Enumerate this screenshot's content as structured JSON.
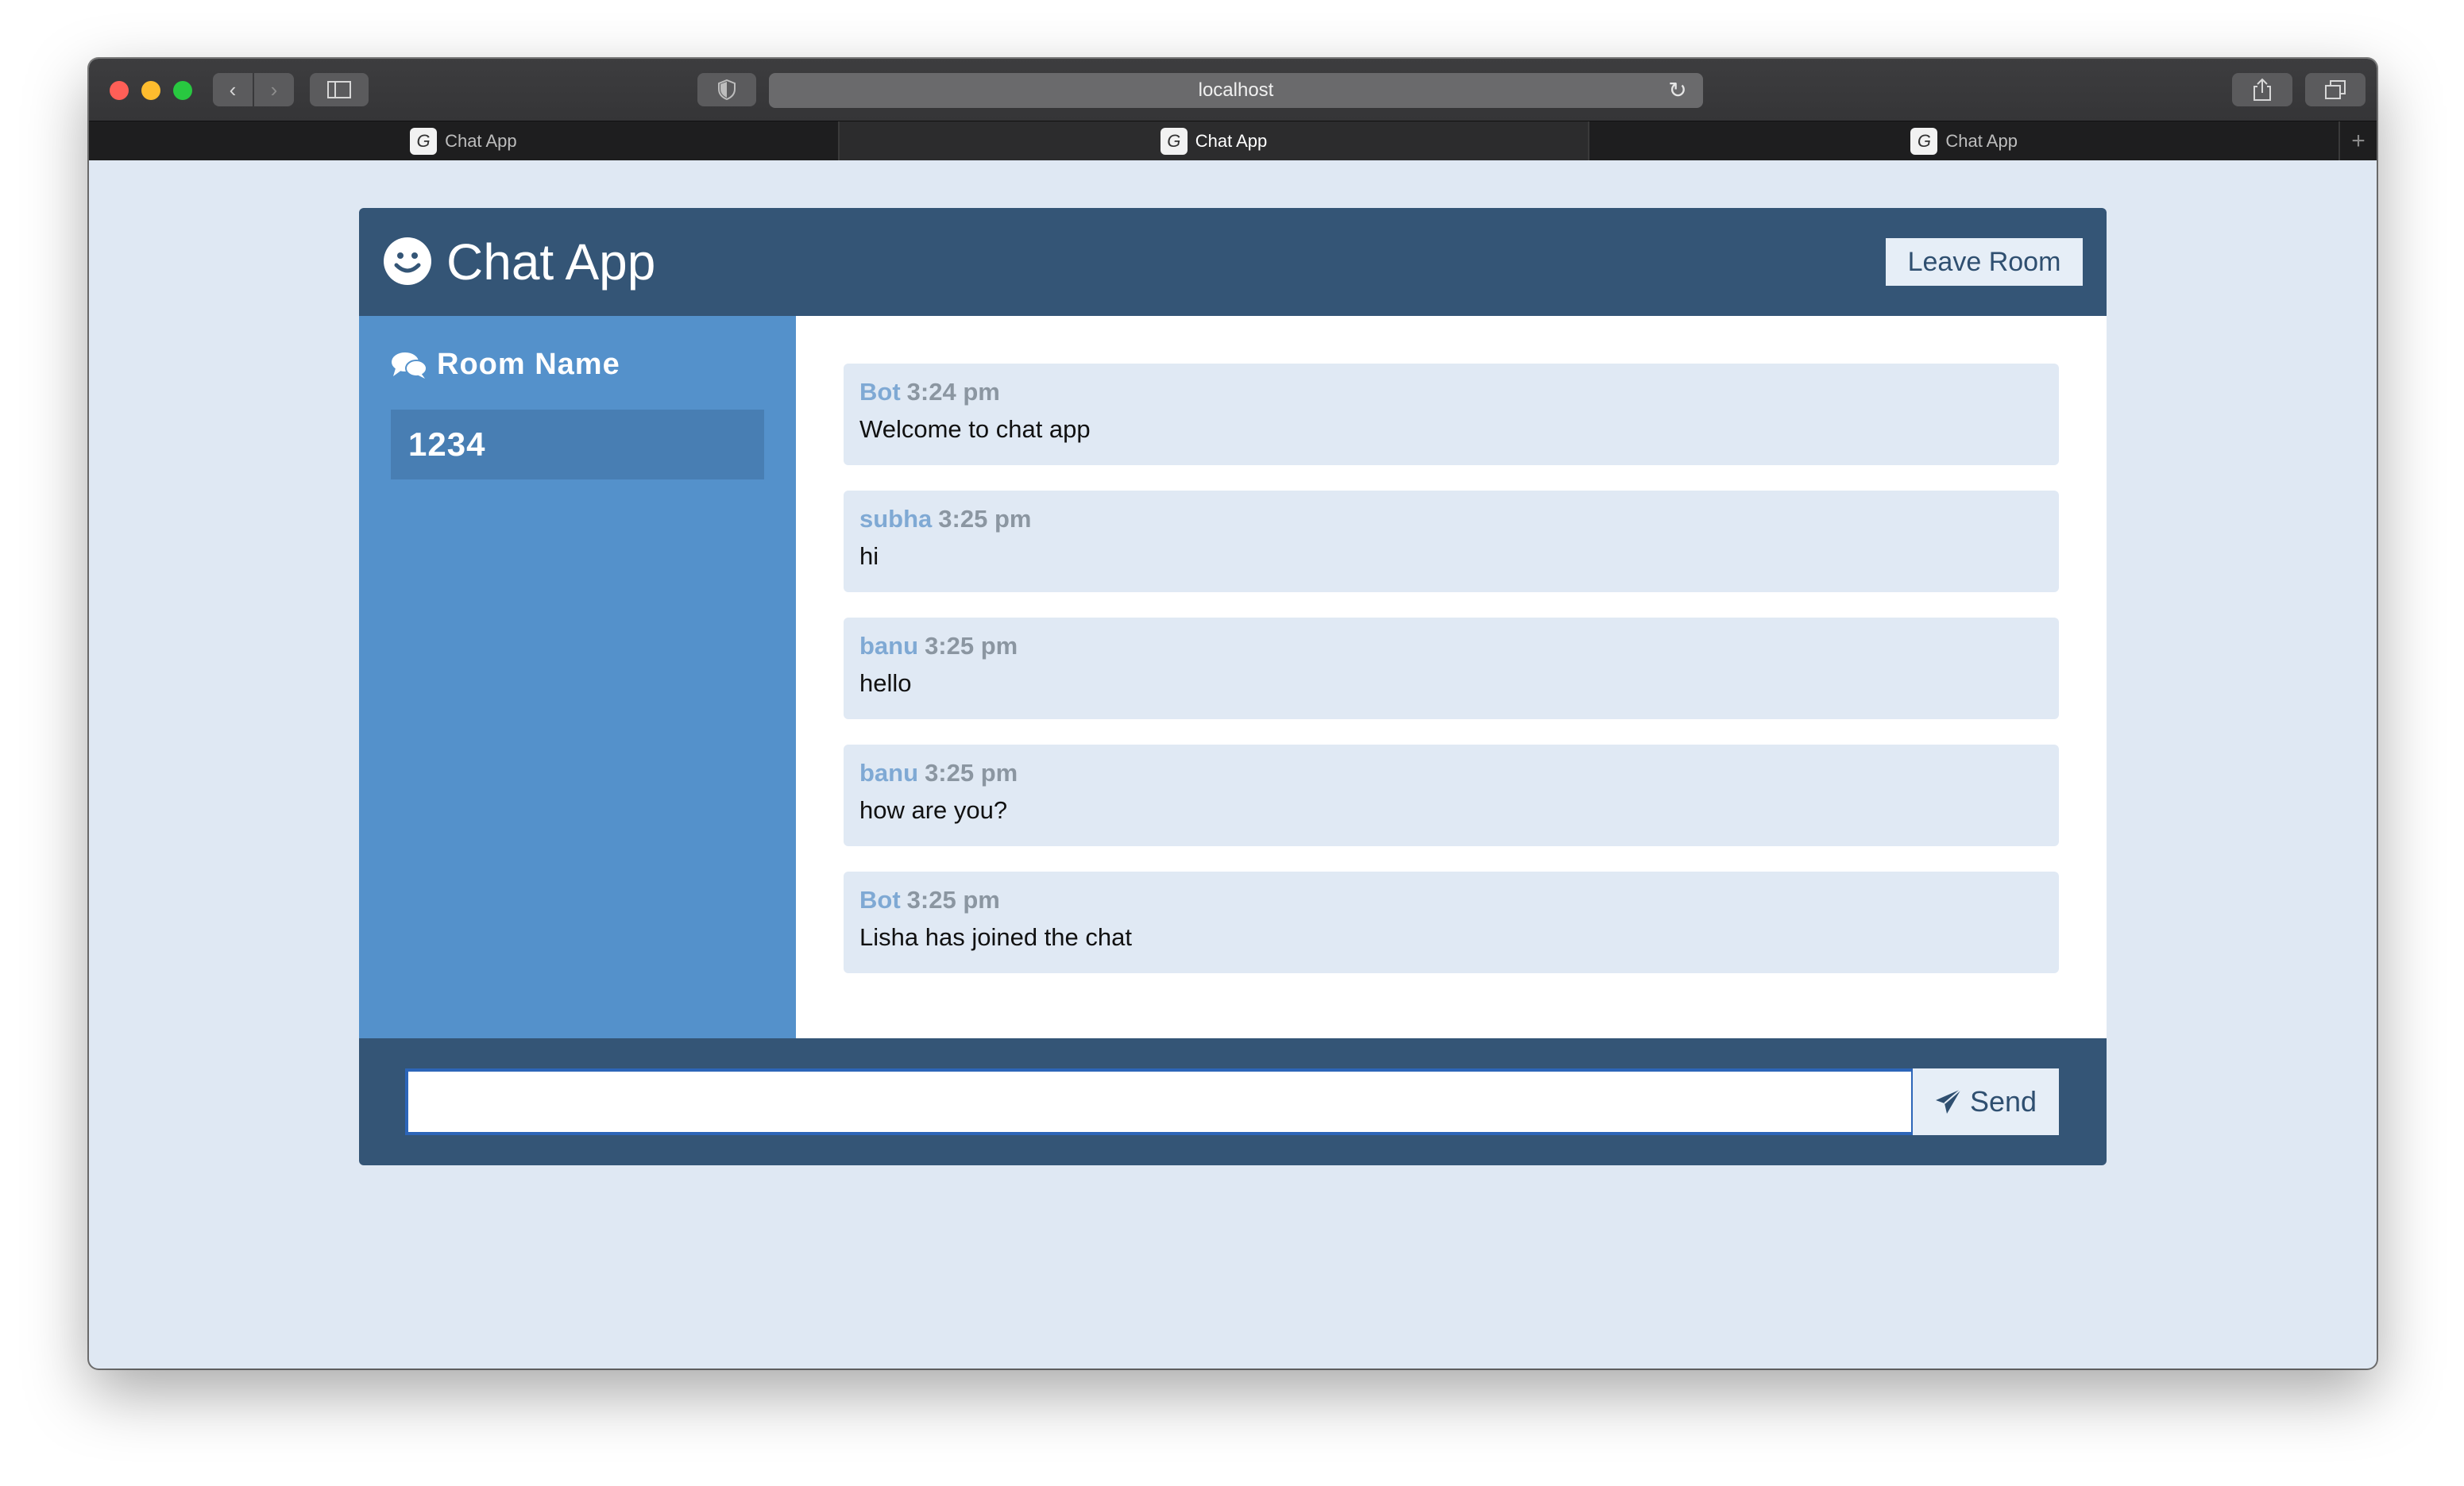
{
  "browser": {
    "url": "localhost",
    "tabs": [
      {
        "label": "Chat App",
        "active": false
      },
      {
        "label": "Chat App",
        "active": true
      },
      {
        "label": "Chat App",
        "active": false
      }
    ],
    "new_tab_label": "+"
  },
  "app": {
    "title": "Chat App",
    "leave_label": "Leave Room"
  },
  "sidebar": {
    "room_heading": "Room Name",
    "room_value": "1234"
  },
  "messages": [
    {
      "user": "Bot",
      "time": "3:24 pm",
      "text": "Welcome to chat app"
    },
    {
      "user": "subha",
      "time": "3:25 pm",
      "text": "hi"
    },
    {
      "user": "banu",
      "time": "3:25 pm",
      "text": "hello"
    },
    {
      "user": "banu",
      "time": "3:25 pm",
      "text": "how are you?"
    },
    {
      "user": "Bot",
      "time": "3:25 pm",
      "text": "Lisha has joined the chat"
    }
  ],
  "composer": {
    "value": "",
    "send_label": "Send"
  },
  "colors": {
    "header": "#345576",
    "sidebar": "#5491cb",
    "message_bg": "#e0e9f4",
    "username": "#7fa9d4"
  }
}
